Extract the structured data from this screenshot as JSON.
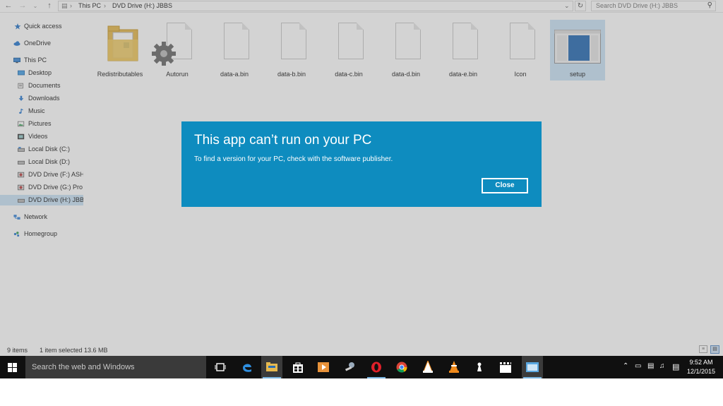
{
  "address": {
    "breadcrumb": [
      "This PC",
      "DVD Drive (H:) JBBS"
    ],
    "search_placeholder": "Search DVD Drive (H:) JBBS"
  },
  "nav": {
    "items": [
      {
        "label": "Quick access",
        "icon": "star-icon"
      },
      {
        "label": "OneDrive",
        "icon": "cloud-icon"
      },
      {
        "label": "This PC",
        "icon": "computer-icon"
      },
      {
        "label": "Desktop",
        "icon": "desktop-icon"
      },
      {
        "label": "Documents",
        "icon": "documents-icon"
      },
      {
        "label": "Downloads",
        "icon": "download-icon"
      },
      {
        "label": "Music",
        "icon": "music-icon"
      },
      {
        "label": "Pictures",
        "icon": "pictures-icon"
      },
      {
        "label": "Videos",
        "icon": "videos-icon"
      },
      {
        "label": "Local Disk (C:)",
        "icon": "drive-icon"
      },
      {
        "label": "Local Disk (D:)",
        "icon": "drive-icon"
      },
      {
        "label": "DVD Drive (F:) ASHE",
        "icon": "dvd-icon"
      },
      {
        "label": "DVD Drive (G:) Pro E",
        "icon": "dvd-icon"
      },
      {
        "label": "DVD Drive (H:) JBBS",
        "icon": "dvd-icon"
      },
      {
        "label": "Network",
        "icon": "network-icon"
      },
      {
        "label": "Homegroup",
        "icon": "homegroup-icon"
      }
    ]
  },
  "files": [
    {
      "name": "Redistributables",
      "icon": "folder-icon"
    },
    {
      "name": "Autorun",
      "icon": "settings-file-icon"
    },
    {
      "name": "data-a.bin",
      "icon": "file-icon"
    },
    {
      "name": "data-b.bin",
      "icon": "file-icon"
    },
    {
      "name": "data-c.bin",
      "icon": "file-icon"
    },
    {
      "name": "data-d.bin",
      "icon": "file-icon"
    },
    {
      "name": "data-e.bin",
      "icon": "file-icon"
    },
    {
      "name": "Icon",
      "icon": "file-icon"
    },
    {
      "name": "setup",
      "icon": "app-icon"
    }
  ],
  "status": {
    "items": "9 items",
    "selected": "1 item selected  13.6 MB"
  },
  "dialog": {
    "title": "This app can’t run on your PC",
    "message": "To find a version for your PC, check with the software publisher.",
    "close_label": "Close"
  },
  "taskbar": {
    "search_placeholder": "Search the web and Windows",
    "time": "9:52 AM",
    "date": "12/1/2015"
  },
  "colors": {
    "dialog_bg": "#0e8cbf",
    "taskbar_bg": "#101010",
    "selection": "#cce4f7"
  }
}
